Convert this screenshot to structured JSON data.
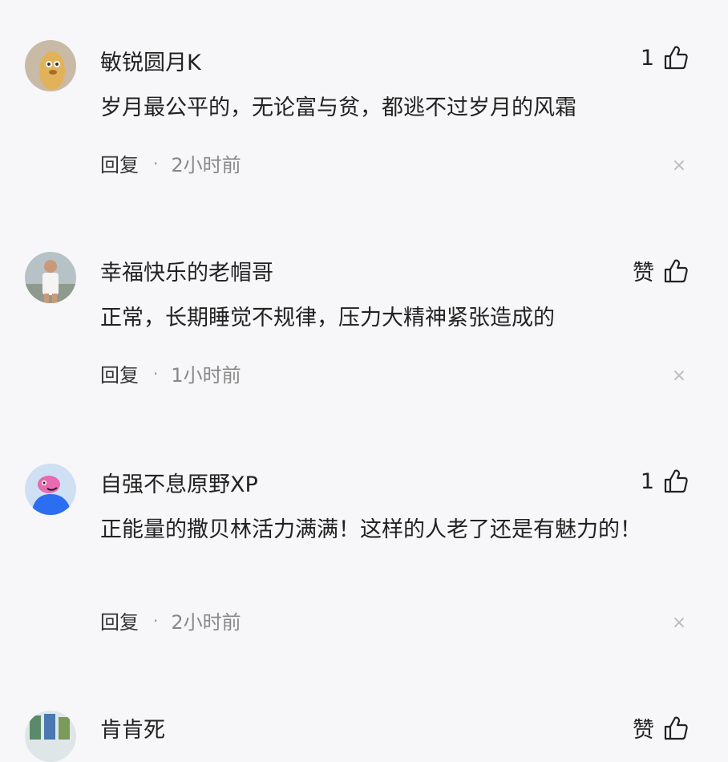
{
  "comments": [
    {
      "username": "敏锐圆月K",
      "like_label": "1",
      "content": "岁月最公平的，无论富与贫，都逃不过岁月的风霜",
      "reply_label": "回复",
      "separator": "·",
      "time": "2小时前",
      "avatar": "avatar-cartoon-icon",
      "avatar_color": "#c8b9a6"
    },
    {
      "username": "幸福快乐的老帽哥",
      "like_label": "赞",
      "content": "正常，长期睡觉不规律，压力大精神紧张造成的",
      "reply_label": "回复",
      "separator": "·",
      "time": "1小时前",
      "avatar": "avatar-photo-icon",
      "avatar_color": "#9aa4a8"
    },
    {
      "username": "自强不息原野XP",
      "like_label": "1",
      "content": "正能量的撒贝林活力满满！这样的人老了还是有魅力的！",
      "reply_label": "回复",
      "separator": "·",
      "time": "2小时前",
      "avatar": "avatar-cartoon-icon",
      "avatar_color": "#2b6ef0"
    },
    {
      "username": "肯肯死",
      "like_label": "赞",
      "avatar": "avatar-photo-icon",
      "avatar_color": "#5a8a6a"
    }
  ],
  "icons": {
    "like": "thumbs-up-icon",
    "close": "close-icon"
  },
  "colors": {
    "background": "#f7f7f9",
    "text": "#222222",
    "secondary_text": "#888888",
    "close_icon": "#bbbbbb"
  },
  "close_glyph": "×"
}
